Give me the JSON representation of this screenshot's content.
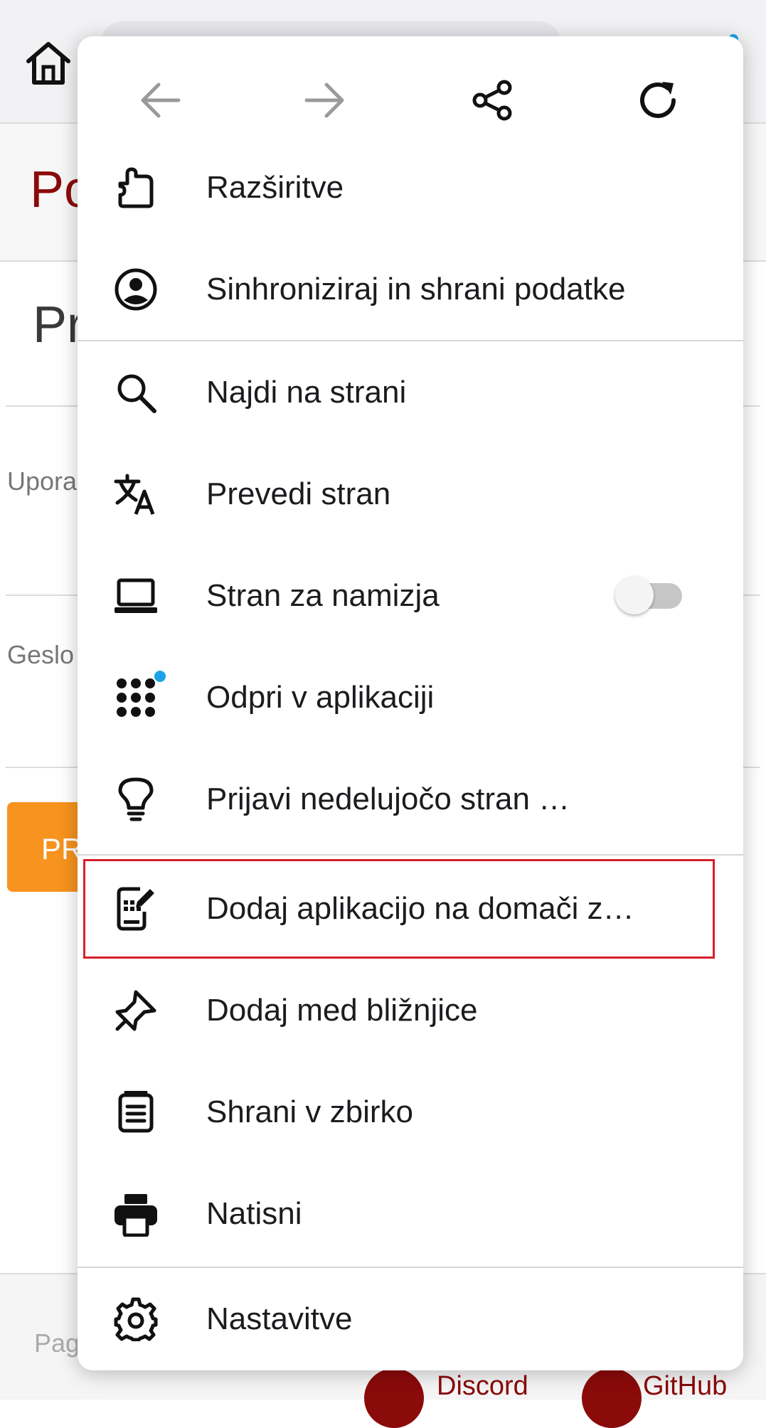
{
  "background": {
    "site_title": "Po",
    "page_heading": "Pr",
    "username_label": "Upora",
    "password_label": "Geslo",
    "submit_label": "PR",
    "footer_text": "Pag",
    "footer_links": [
      "Discord",
      "GitHub"
    ]
  },
  "menu": {
    "nav": [
      {
        "name": "back-icon",
        "enabled": false
      },
      {
        "name": "forward-icon",
        "enabled": false
      },
      {
        "name": "share-icon",
        "enabled": true
      },
      {
        "name": "reload-icon",
        "enabled": true
      }
    ],
    "items": [
      {
        "label": "Razširitve",
        "icon": "extensions-icon"
      },
      {
        "label": "Sinhroniziraj in shrani podatke",
        "icon": "account-icon"
      },
      {
        "label": "Najdi na strani",
        "icon": "search-icon"
      },
      {
        "label": "Prevedi stran",
        "icon": "translate-icon"
      },
      {
        "label": "Stran za namizja",
        "icon": "laptop-icon",
        "toggle": false
      },
      {
        "label": "Odpri v aplikaciji",
        "icon": "app-grid-icon",
        "badge": true
      },
      {
        "label": "Prijavi nedelujočo stran …",
        "icon": "lightbulb-icon"
      },
      {
        "label": "Dodaj aplikacijo na domači z…",
        "icon": "add-to-home-icon",
        "highlighted": true
      },
      {
        "label": "Dodaj med bližnjice",
        "icon": "pin-icon"
      },
      {
        "label": "Shrani v zbirko",
        "icon": "collection-icon"
      },
      {
        "label": "Natisni",
        "icon": "print-icon"
      },
      {
        "label": "Nastavitve",
        "icon": "settings-icon"
      }
    ]
  },
  "colors": {
    "accent_red": "#8b0a0a",
    "highlight_border": "#d6202a",
    "notification": "#1aa3e8",
    "button_orange": "#f7931e"
  }
}
